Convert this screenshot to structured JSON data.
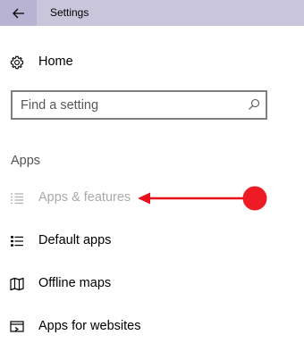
{
  "window": {
    "title": "Settings",
    "back_icon": "back-arrow-icon"
  },
  "nav": {
    "home": {
      "label": "Home",
      "icon": "gear-icon"
    }
  },
  "search": {
    "placeholder": "Find a setting",
    "value": "",
    "icon": "search-icon"
  },
  "section": {
    "heading": "Apps",
    "items": [
      {
        "label": "Apps & features",
        "icon": "apps-list-icon",
        "state": "selected-disabled"
      },
      {
        "label": "Default apps",
        "icon": "default-apps-icon"
      },
      {
        "label": "Offline maps",
        "icon": "map-icon"
      },
      {
        "label": "Apps for websites",
        "icon": "apps-for-websites-icon"
      }
    ]
  },
  "annotation": {
    "type": "red-arrow",
    "color": "#e8101a",
    "points_to": "Apps & features"
  },
  "colors": {
    "titlebar": "#c9c5db",
    "back_button": "#b8b2d3",
    "disabled_text": "#a9a9a9"
  }
}
